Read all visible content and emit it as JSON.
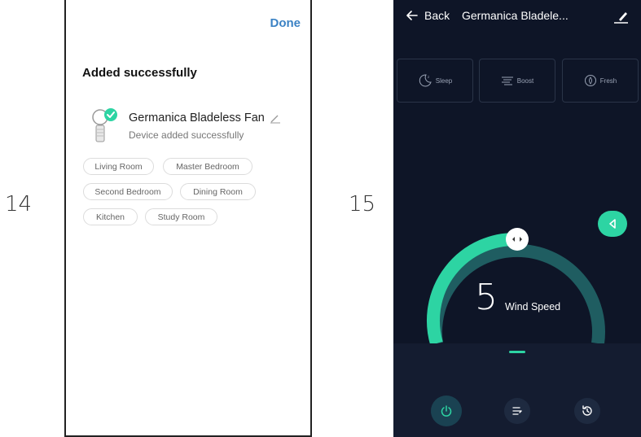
{
  "steps": {
    "left": "14",
    "right": "15"
  },
  "screen14": {
    "done_label": "Done",
    "title": "Added successfully",
    "device_name": "Germanica Bladeless Fan",
    "device_status": "Device added successfully",
    "rooms": [
      "Living Room",
      "Master Bedroom",
      "Second Bedroom",
      "Dining Room",
      "Kitchen",
      "Study Room"
    ],
    "accent": "#2dd4a3"
  },
  "screen15": {
    "back_label": "Back",
    "device_title": "Germanica Bladele...",
    "modes": [
      {
        "label": "Sleep",
        "icon": "moon-icon"
      },
      {
        "label": "Boost",
        "icon": "boost-icon"
      },
      {
        "label": "Fresh",
        "icon": "leaf-icon"
      }
    ],
    "wind_speed_value": "5",
    "wind_speed_label": "Wind Speed",
    "controls": [
      {
        "name": "power",
        "icon": "power-icon"
      },
      {
        "name": "oscillation",
        "icon": "oscillate-icon"
      },
      {
        "name": "timer",
        "icon": "timer-icon"
      }
    ],
    "colors": {
      "background": "#0e1527",
      "accent": "#2dd4a3",
      "gauge_track": "#1f5d61"
    }
  }
}
